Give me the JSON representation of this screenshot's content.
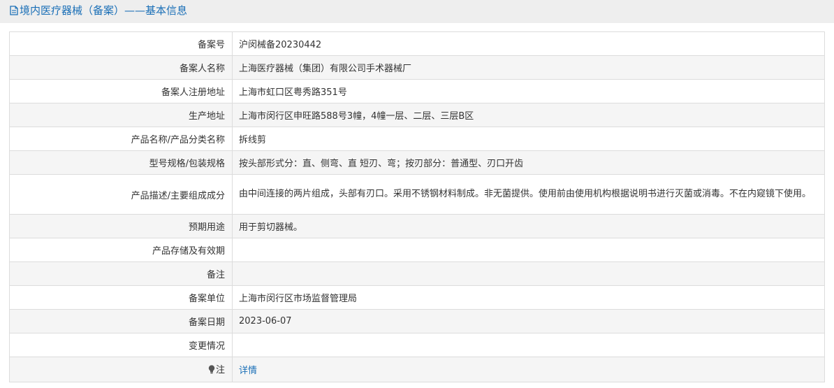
{
  "header": {
    "title": "境内医疗器械（备案）——基本信息"
  },
  "rows": [
    {
      "label": "备案号",
      "value": "沪闵械备20230442"
    },
    {
      "label": "备案人名称",
      "value": "上海医疗器械（集团）有限公司手术器械厂"
    },
    {
      "label": "备案人注册地址",
      "value": "上海市虹口区粤秀路351号"
    },
    {
      "label": "生产地址",
      "value": "上海市闵行区申旺路588号3幢，4幢一层、二层、三层B区"
    },
    {
      "label": "产品名称/产品分类名称",
      "value": "拆线剪"
    },
    {
      "label": "型号规格/包装规格",
      "value": "按头部形式分：直、侧弯、直 短刃、弯；按刃部分：普通型、刃口开齿"
    },
    {
      "label": "产品描述/主要组成成分",
      "value": "由中间连接的两片组成，头部有刃口。采用不锈钢材料制成。非无菌提供。使用前由使用机构根据说明书进行灭菌或消毒。不在内窥镜下使用。"
    },
    {
      "label": "预期用途",
      "value": "用于剪切器械。"
    },
    {
      "label": "产品存储及有效期",
      "value": ""
    },
    {
      "label": "备注",
      "value": ""
    },
    {
      "label": "备案单位",
      "value": "上海市闵行区市场监督管理局"
    },
    {
      "label": "备案日期",
      "value": "2023-06-07"
    },
    {
      "label": "变更情况",
      "value": ""
    },
    {
      "label": "注",
      "value": "详情"
    }
  ],
  "colors": {
    "header_text": "#1a6fb7",
    "link": "#1a6fb7",
    "border": "#dcdcdc",
    "row_alt": "#f5f5f5"
  }
}
